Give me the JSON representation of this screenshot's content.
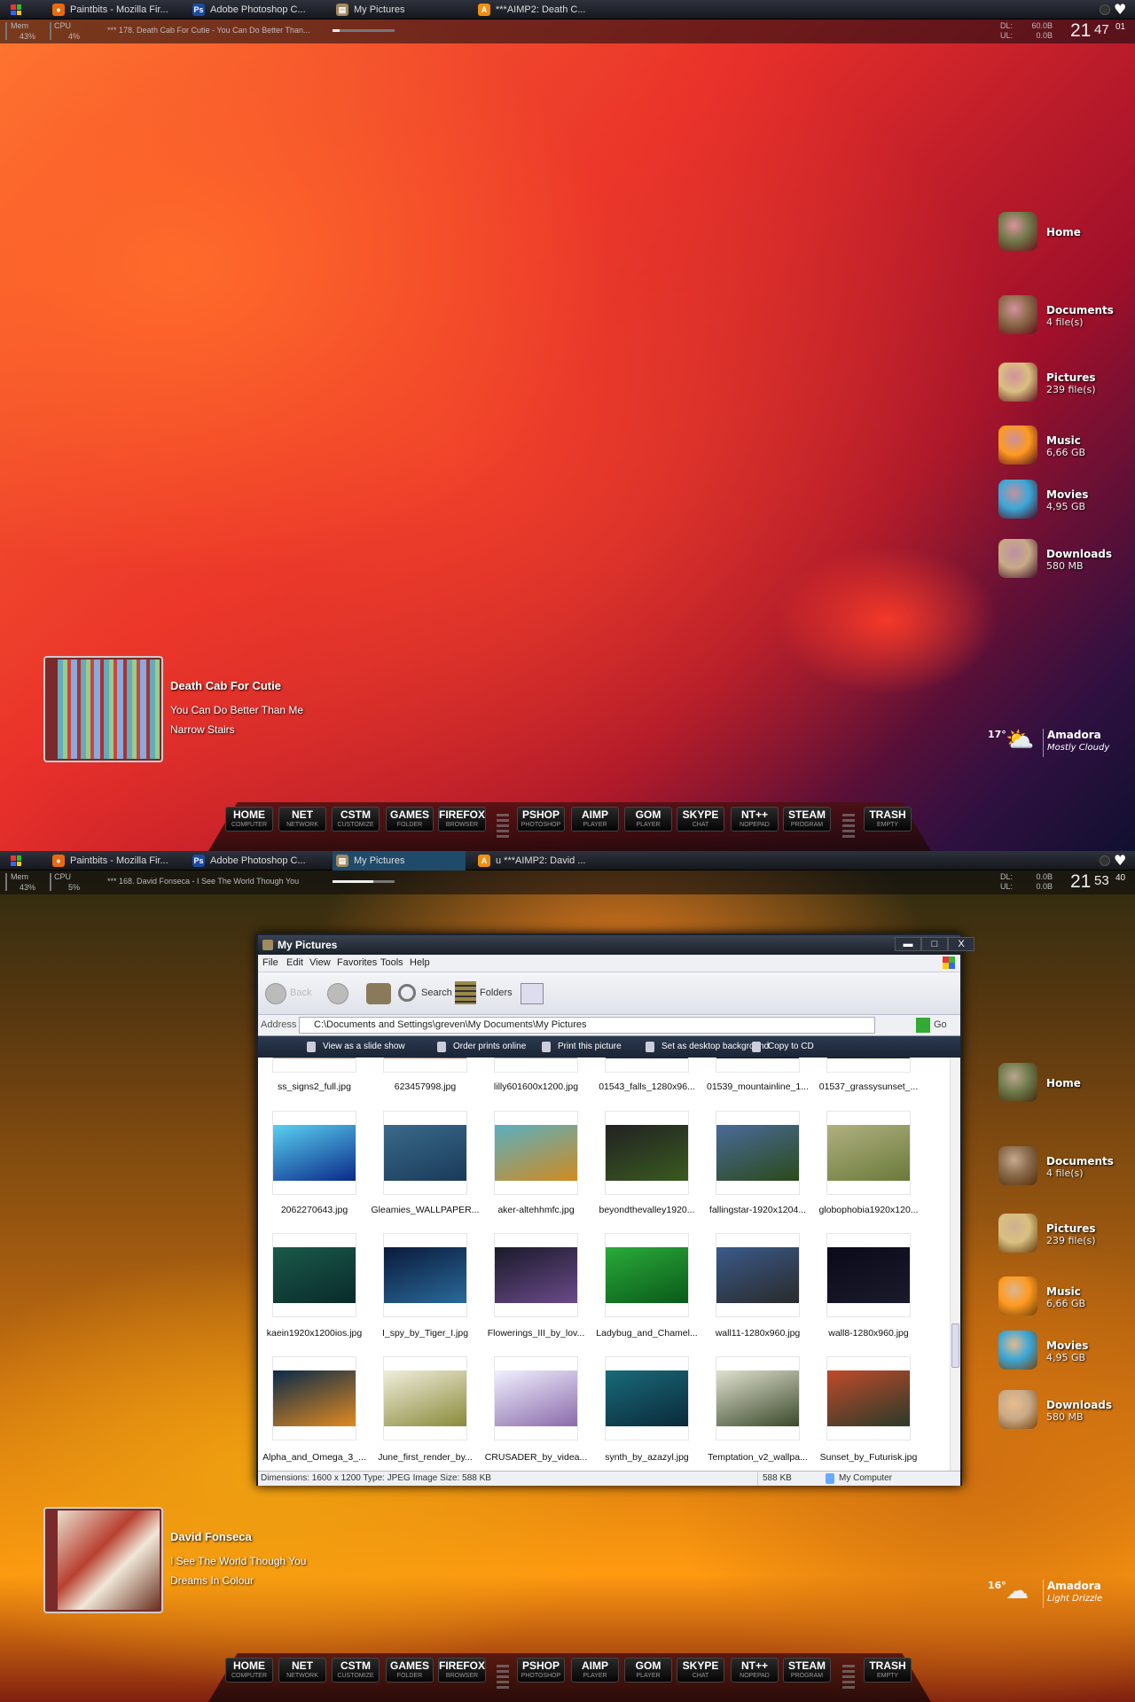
{
  "desktop_icons": [
    {
      "name": "Home",
      "sub": "",
      "icon": "satchel-icon",
      "color": "#6f7a4a"
    },
    {
      "name": "Documents",
      "sub": "4 file(s)",
      "icon": "book-icon",
      "color": "#8a6a4a"
    },
    {
      "name": "Pictures",
      "sub": "239 file(s)",
      "icon": "map-icon",
      "color": "#d8c080"
    },
    {
      "name": "Music",
      "sub": "6,66 GB",
      "icon": "lanterns-icon",
      "color": "#ff9a20"
    },
    {
      "name": "Movies",
      "sub": "4,95 GB",
      "icon": "scroll-case-icon",
      "color": "#3aa8d8"
    },
    {
      "name": "Downloads",
      "sub": "580 MB",
      "icon": "pouch-icon",
      "color": "#c8aa88"
    }
  ],
  "dock": {
    "buttons": [
      {
        "title": "HOME",
        "sub": "COMPUTER"
      },
      {
        "title": "NET",
        "sub": "NETWORK"
      },
      {
        "title": "CSTM",
        "sub": "CUSTOMIZE"
      },
      {
        "title": "GAMES",
        "sub": "FOLDER"
      },
      {
        "title": "FIREFOX",
        "sub": "BROWSER"
      },
      {
        "title": "PSHOP",
        "sub": "PHOTOSHOP"
      },
      {
        "title": "AIMP",
        "sub": "PLAYER"
      },
      {
        "title": "GOM",
        "sub": "PLAYER"
      },
      {
        "title": "SKYPE",
        "sub": "CHAT"
      },
      {
        "title": "NT++",
        "sub": "NOPEPAD"
      },
      {
        "title": "STEAM",
        "sub": "PROGRAM"
      },
      {
        "title": "TRASH",
        "sub": "EMPTY"
      }
    ]
  },
  "screens": [
    {
      "taskbar": {
        "tabs": [
          {
            "label": "Paintbits - Mozilla Fir...",
            "icon": "firefox-icon",
            "active": false
          },
          {
            "label": "Adobe Photoshop C...",
            "icon": "photoshop-icon",
            "active": false
          },
          {
            "label": "My Pictures",
            "icon": "folder-pictures-icon",
            "active": false
          },
          {
            "label": "***AIMP2: Death C...",
            "icon": "aimp-icon",
            "active": false
          }
        ]
      },
      "info": {
        "mem_label": "Mem",
        "mem_value": "43%",
        "cpu_label": "CPU",
        "cpu_value": "4%",
        "track": "*** 178. Death Cab For Cutie - You Can Do Better Than...",
        "progress": 0.12,
        "dl_label": "DL:",
        "dl": "60.0B",
        "ul_label": "UL:",
        "ul": "0.0B",
        "clock_h": "21",
        "clock_m": "47",
        "clock_s": "01"
      },
      "now_playing": {
        "artist": "Death Cab For Cutie",
        "title": "You Can Do Better Than Me",
        "album": "Narrow Stairs"
      },
      "weather": {
        "temp": "17°",
        "city": "Amadora",
        "condition": "Mostly Cloudy",
        "icon": "partly-cloudy-icon"
      }
    },
    {
      "taskbar": {
        "tabs": [
          {
            "label": "Paintbits - Mozilla Fir...",
            "icon": "firefox-icon",
            "active": false
          },
          {
            "label": "Adobe Photoshop C...",
            "icon": "photoshop-icon",
            "active": false
          },
          {
            "label": "My Pictures",
            "icon": "folder-pictures-icon",
            "active": true
          },
          {
            "label": "u ***AIMP2: David ...",
            "icon": "aimp-icon",
            "active": false
          }
        ]
      },
      "info": {
        "mem_label": "Mem",
        "mem_value": "43%",
        "cpu_label": "CPU",
        "cpu_value": "5%",
        "track": "*** 168. David Fonseca - I See The World Though You",
        "progress": 0.65,
        "dl_label": "DL:",
        "dl": "0.0B",
        "ul_label": "UL:",
        "ul": "0.0B",
        "clock_h": "21",
        "clock_m": "53",
        "clock_s": "40"
      },
      "now_playing": {
        "artist": "David Fonseca",
        "title": "I See The World Though You",
        "album": "Dreams In Colour"
      },
      "weather": {
        "temp": "16°",
        "city": "Amadora",
        "condition": "Light Drizzle",
        "icon": "drizzle-icon"
      }
    }
  ],
  "explorer": {
    "title": "My Pictures",
    "controls": {
      "minimize": "▬",
      "maximize": "□",
      "close": "X"
    },
    "menu": [
      "File",
      "Edit",
      "View",
      "Favorites",
      "Tools",
      "Help"
    ],
    "toolbar": {
      "back": "Back",
      "search": "Search",
      "folders": "Folders"
    },
    "address": {
      "label": "Address",
      "path": "C:\\Documents and Settings\\greven\\My Documents\\My Pictures",
      "go": "Go"
    },
    "tasks": [
      "View as a slide show",
      "Order prints online",
      "Print this picture",
      "Set as desktop background",
      "Copy to CD"
    ],
    "files": [
      {
        "name": "ss_signs2_full.jpg",
        "colors": [
          "#ccc",
          "#a76"
        ]
      },
      {
        "name": "623457998.jpg",
        "colors": [
          "#ddd",
          "#a54"
        ]
      },
      {
        "name": "lilly601600x1200.jpg",
        "colors": [
          "#ccc",
          "#999"
        ]
      },
      {
        "name": "01543_falls_1280x96...",
        "colors": [
          "#345",
          "#223"
        ]
      },
      {
        "name": "01539_mountainline_1...",
        "colors": [
          "#111",
          "#222"
        ]
      },
      {
        "name": "01537_grassysunset_...",
        "colors": [
          "#121",
          "#231"
        ]
      },
      {
        "name": "2062270643.jpg",
        "colors": [
          "#5ad0f0",
          "#0a2a8a"
        ]
      },
      {
        "name": "Gleamies_WALLPAPER...",
        "colors": [
          "#3a6a8a",
          "#1a3a5a"
        ]
      },
      {
        "name": "aker-altehhmfc.jpg",
        "colors": [
          "#5ab0c0",
          "#d08a20"
        ]
      },
      {
        "name": "beyondthevalley1920...",
        "colors": [
          "#222",
          "#3a5a20"
        ]
      },
      {
        "name": "fallingstar-1920x1204...",
        "colors": [
          "#4a6a9a",
          "#2a4a1a"
        ]
      },
      {
        "name": "globophobia1920x120...",
        "colors": [
          "#b0b080",
          "#6a7a3a"
        ]
      },
      {
        "name": "kaein1920x1200ios.jpg",
        "colors": [
          "#1a5a4a",
          "#0a2a2a"
        ]
      },
      {
        "name": "I_spy_by_Tiger_I.jpg",
        "colors": [
          "#0a1a3a",
          "#2a6a9a"
        ]
      },
      {
        "name": "Flowerings_III_by_lov...",
        "colors": [
          "#1a1a2a",
          "#6a4a8a"
        ]
      },
      {
        "name": "Ladybug_and_Chamel...",
        "colors": [
          "#2aaa3a",
          "#0a5a1a"
        ]
      },
      {
        "name": "wall11-1280x960.jpg",
        "colors": [
          "#3a5a8a",
          "#2a2a2a"
        ]
      },
      {
        "name": "wall8-1280x960.jpg",
        "colors": [
          "#0a0a1a",
          "#1a1a2a"
        ]
      },
      {
        "name": "Alpha_and_Omega_3_...",
        "colors": [
          "#0a2a4a",
          "#e08a20"
        ]
      },
      {
        "name": "June_first_render_by...",
        "colors": [
          "#f0eedc",
          "#8a8a3a"
        ]
      },
      {
        "name": "CRUSADER_by_videa...",
        "colors": [
          "#f0f0ff",
          "#8a6aaa"
        ]
      },
      {
        "name": "synth_by_azazyl.jpg",
        "colors": [
          "#1a6a7a",
          "#0a2a3a"
        ]
      },
      {
        "name": "Temptation_v2_wallpa...",
        "colors": [
          "#e0e0d0",
          "#3a4a2a"
        ]
      },
      {
        "name": "Sunset_by_Futurisk.jpg",
        "colors": [
          "#c04a2a",
          "#2a3a2a"
        ]
      }
    ],
    "status": {
      "text": "Dimensions: 1600 x 1200 Type: JPEG Image Size: 588 KB",
      "size": "588 KB",
      "zone": "My Computer"
    }
  }
}
